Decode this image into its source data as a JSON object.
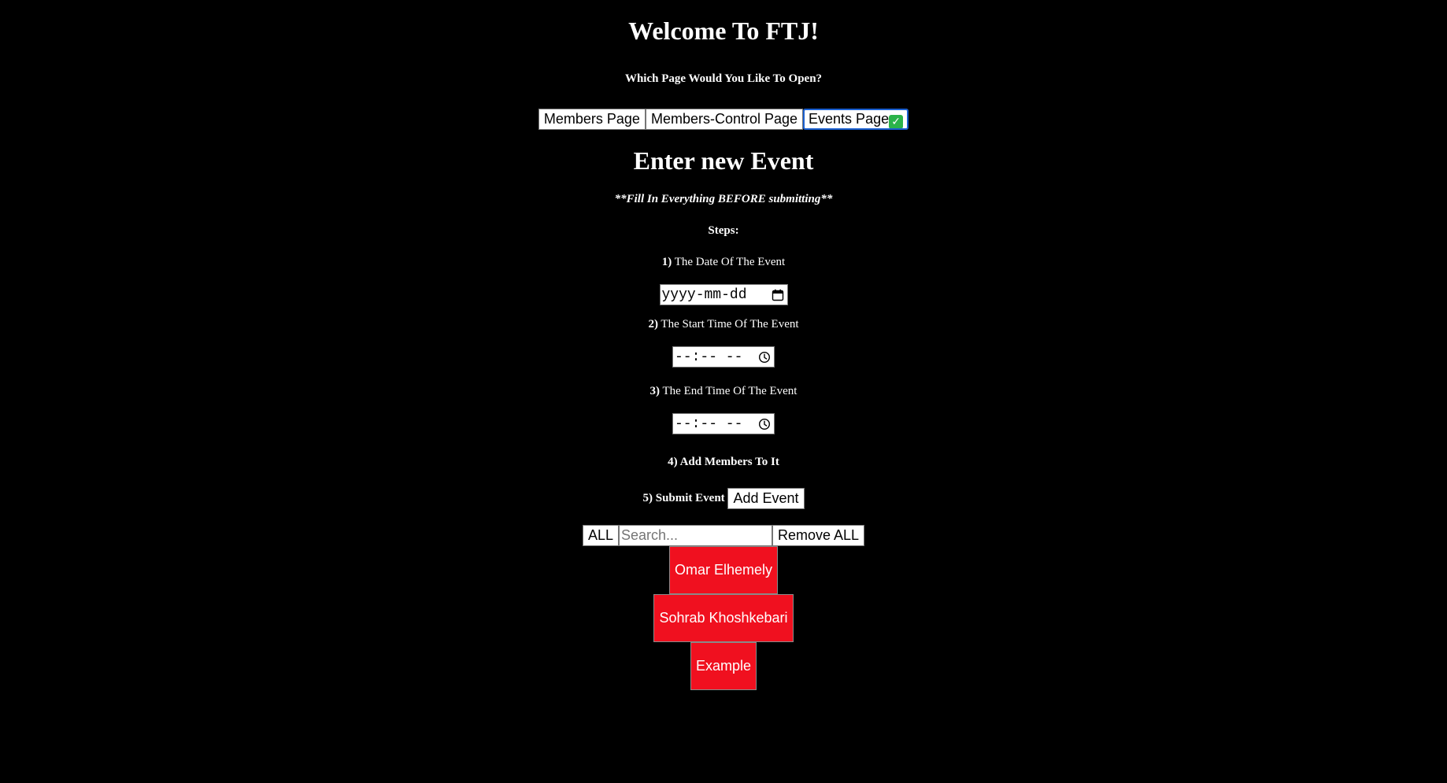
{
  "header": {
    "title": "Welcome To FTJ!",
    "subtitle": "Which Page Would You Like To Open?"
  },
  "nav": {
    "members_page": "Members Page",
    "members_control_page": "Members-Control Page",
    "events_page": "Events Page",
    "active_check": "✓"
  },
  "form": {
    "title": "Enter new Event",
    "note": "**Fill In Everything BEFORE submitting**",
    "steps_title": "Steps:",
    "step1_num": "1)",
    "step1_text": " The Date Of The Event",
    "date_placeholder": "yyyy-mm-dd",
    "step2_num": "2)",
    "step2_text": " The Start Time Of The Event",
    "start_time_placeholder": "--:-- --",
    "step3_num": "3)",
    "step3_text": " The End Time Of The Event",
    "end_time_placeholder": "--:-- --",
    "step4": "4) Add Members To It",
    "step5": "5) Submit Event",
    "add_event_label": "Add Event"
  },
  "member_controls": {
    "all_label": "ALL",
    "search_placeholder": "Search...",
    "remove_all_label": "Remove ALL"
  },
  "members": [
    "Omar Elhemely",
    "Sohrab Khoshkebari",
    "Example"
  ],
  "colors": {
    "background": "#000000",
    "member_button": "#f0101f",
    "active_outline": "#1a5fd0",
    "check_green": "#2bb34a"
  }
}
